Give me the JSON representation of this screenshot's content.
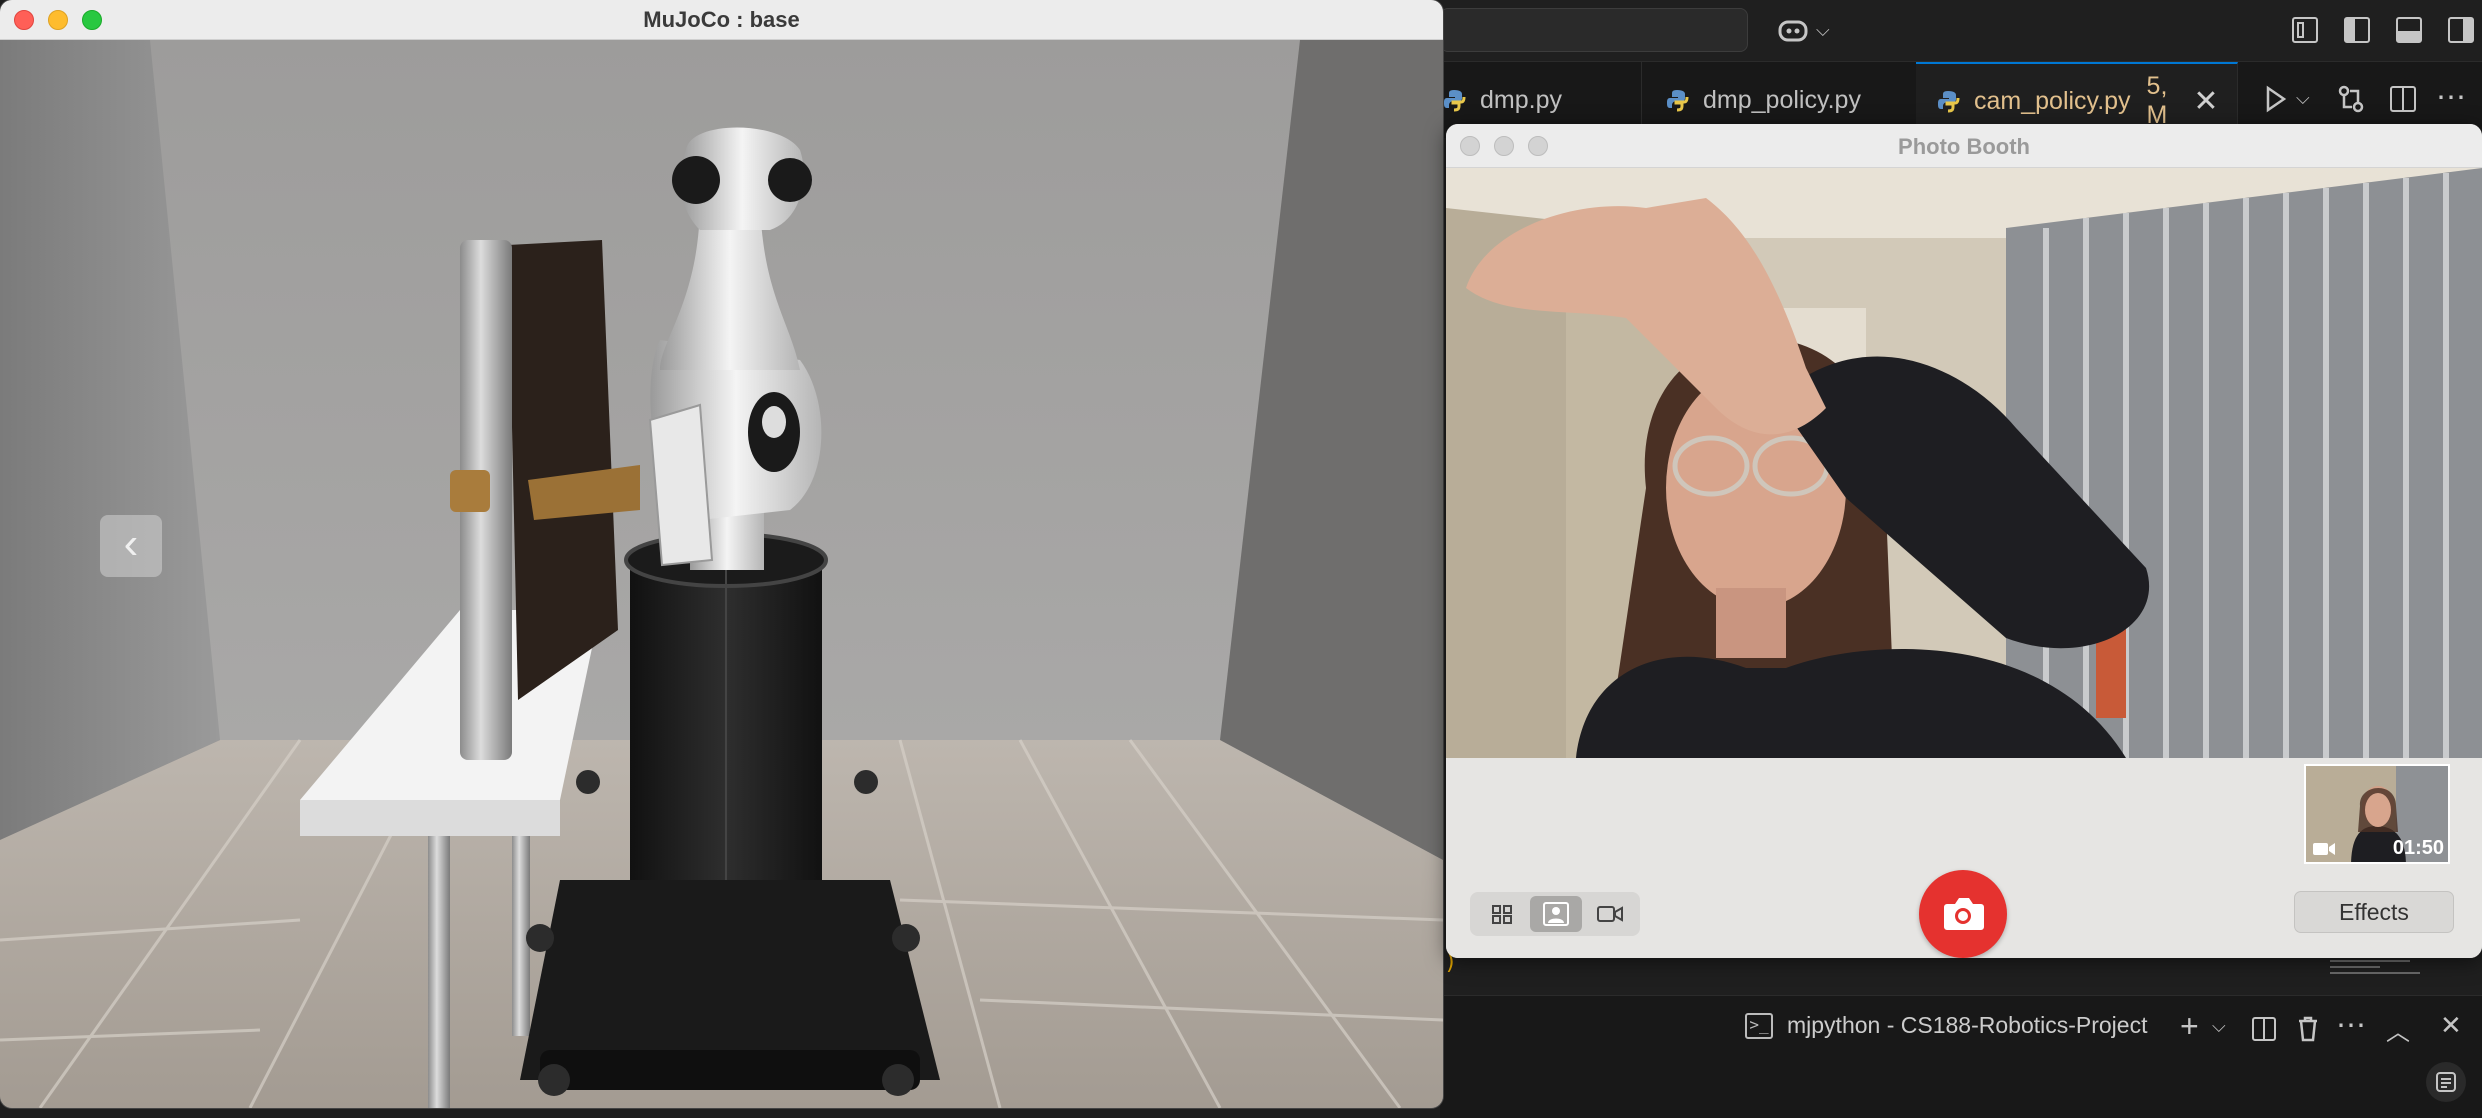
{
  "mujoco": {
    "title": "MuJoCo : base",
    "prev_icon": "chevron-left-icon"
  },
  "vscode": {
    "tabs": [
      {
        "label": "dmp.py",
        "icon": "python-file-icon"
      },
      {
        "label": "dmp_policy.py",
        "icon": "python-file-icon"
      },
      {
        "label": "cam_policy.py",
        "icon": "python-file-icon",
        "badge": "5, M",
        "active": true
      }
    ],
    "terminal": {
      "title": "mjpython - CS188-Robotics-Project"
    },
    "accent_color": "#0078d4",
    "modified_tab_color": "#e2c08d"
  },
  "photobooth": {
    "title": "Photo Booth",
    "effects_label": "Effects",
    "thumbnail_time": "01:50",
    "shutter_color": "#e5322f",
    "mode_icons": [
      "grid-icon",
      "portrait-icon",
      "video-icon"
    ],
    "selected_mode": "portrait-icon"
  }
}
